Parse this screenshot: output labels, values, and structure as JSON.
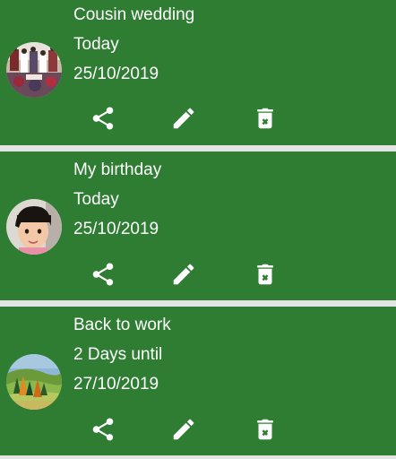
{
  "colors": {
    "card_background": "#2e7d32",
    "divider": "#e3e3e3",
    "text": "#ffffff"
  },
  "events": [
    {
      "title": "Cousin wedding",
      "status": "Today",
      "date": "25/10/2019",
      "avatar": "wedding-photo",
      "actions": [
        "share-icon",
        "edit-icon",
        "delete-icon"
      ]
    },
    {
      "title": "My birthday",
      "status": "Today",
      "date": "25/10/2019",
      "avatar": "child-portrait-photo",
      "actions": [
        "share-icon",
        "edit-icon",
        "delete-icon"
      ]
    },
    {
      "title": "Back to work",
      "status": "2 Days until",
      "date": "27/10/2019",
      "avatar": "landscape-photo",
      "actions": [
        "share-icon",
        "edit-icon",
        "delete-icon"
      ]
    }
  ]
}
